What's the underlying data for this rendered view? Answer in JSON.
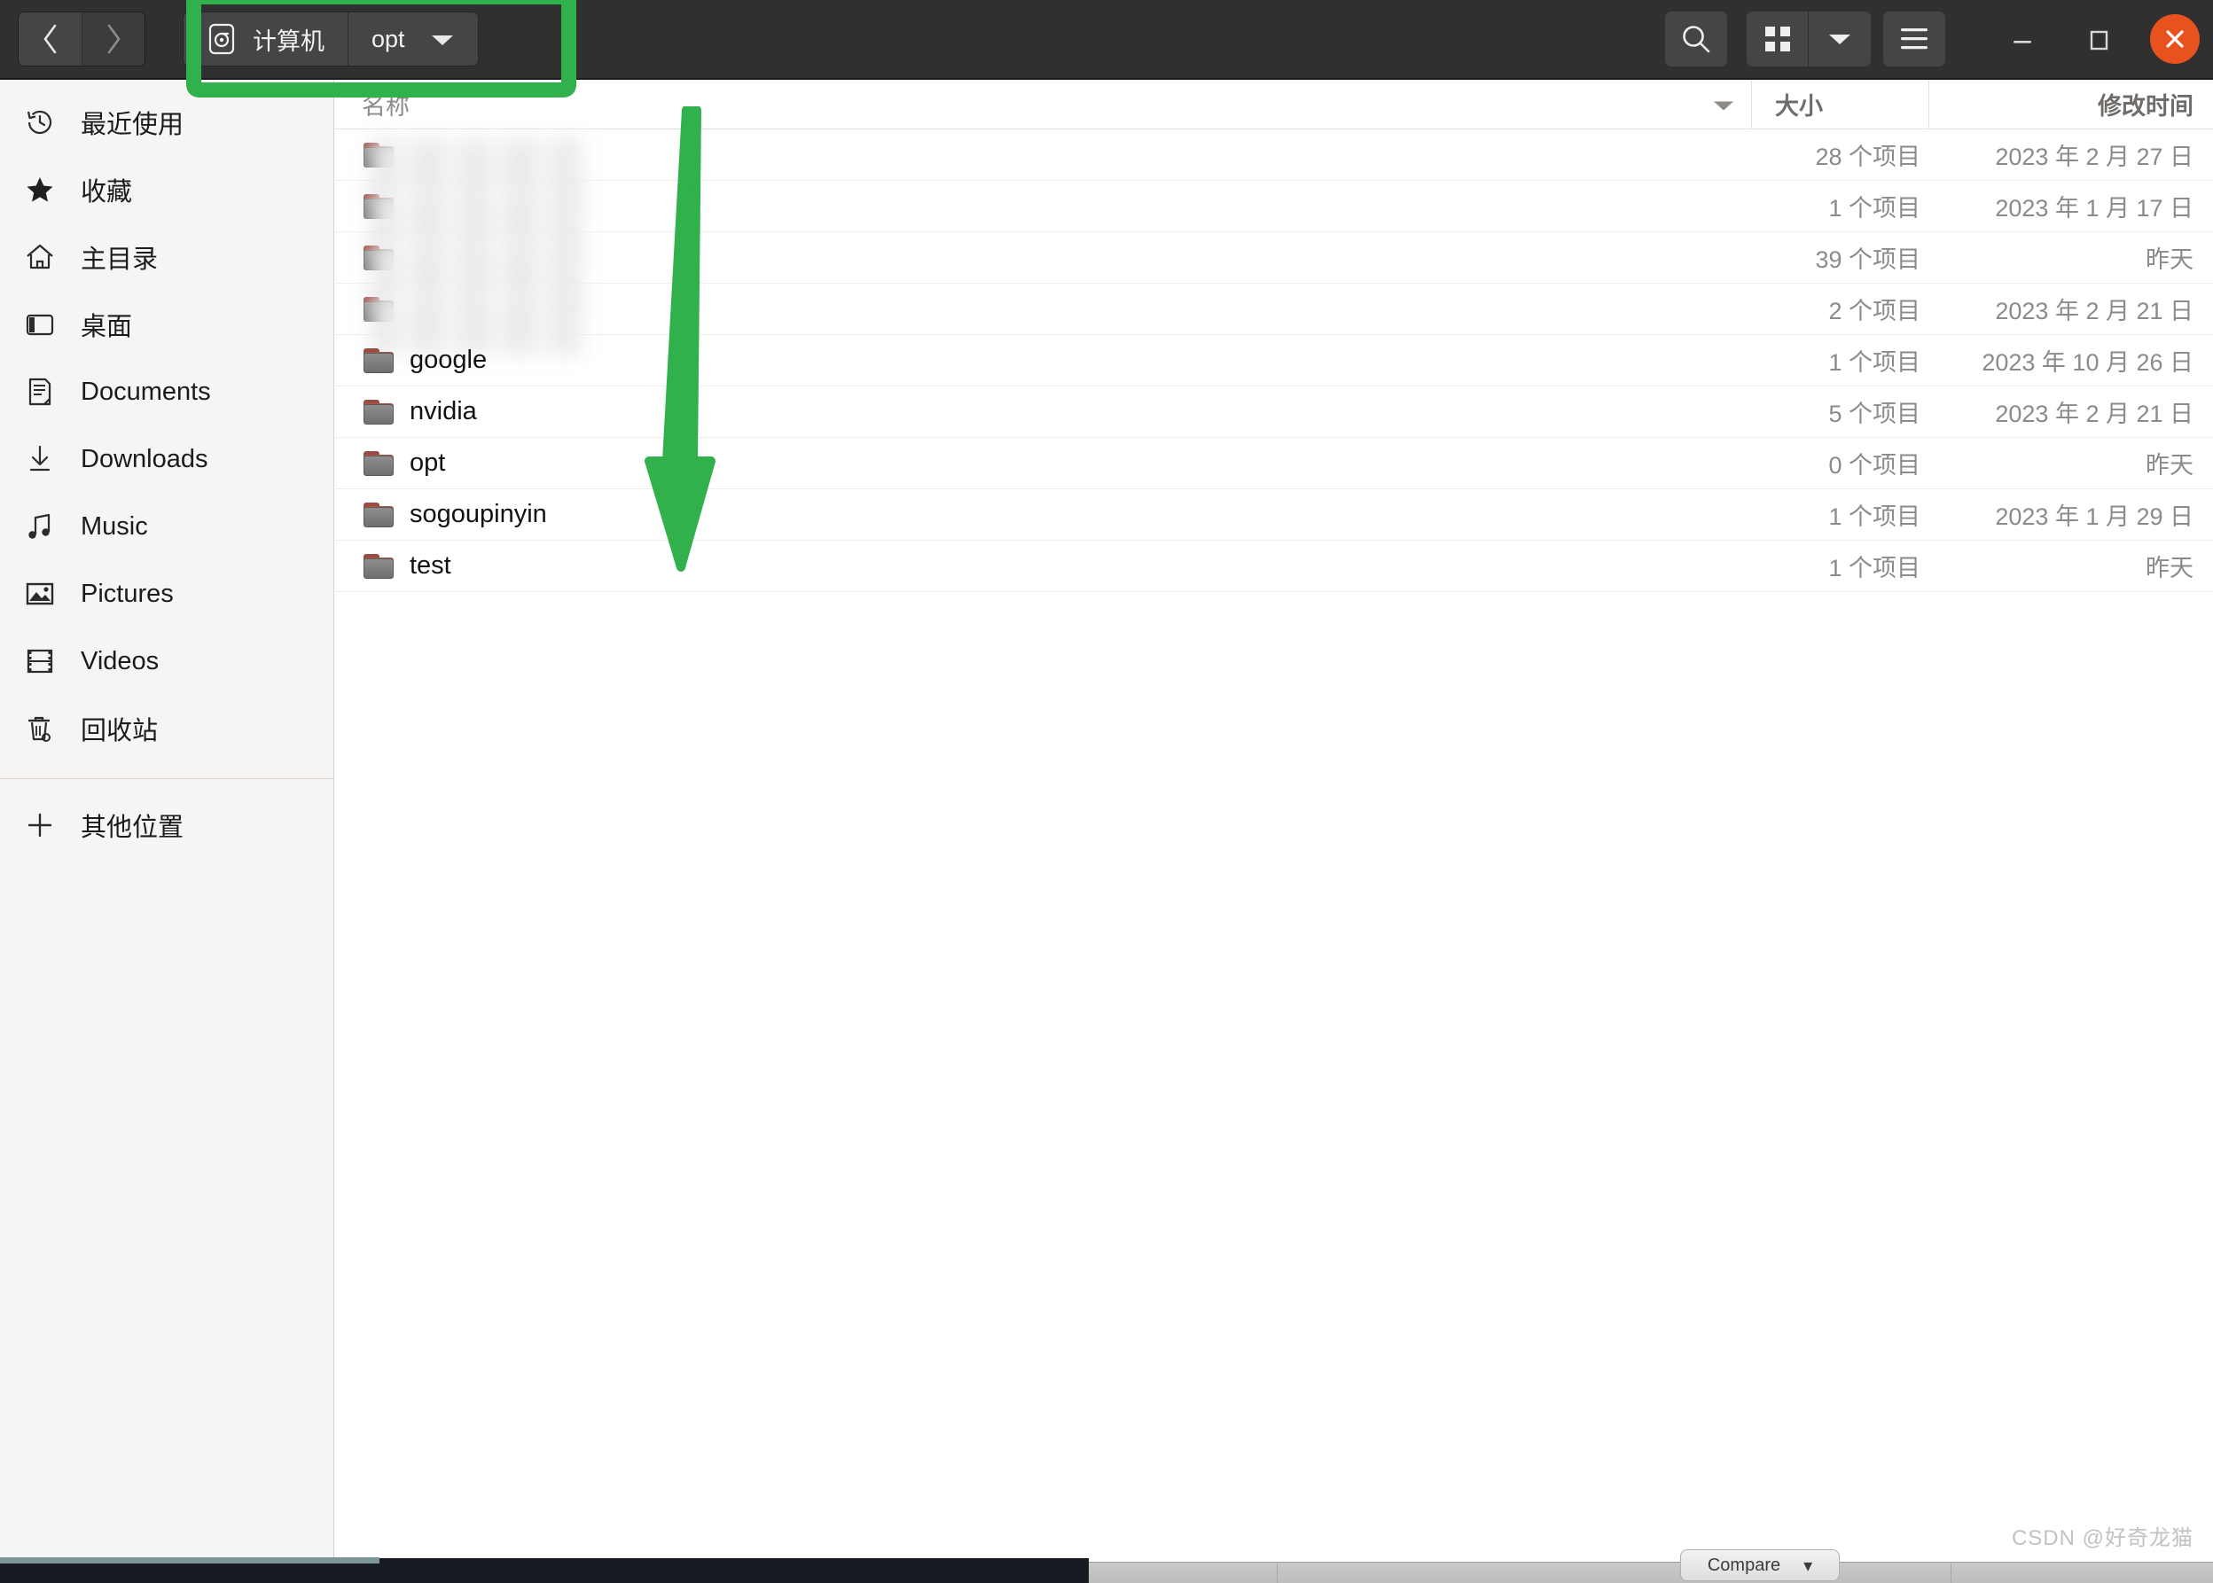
{
  "window": {
    "titlebar": {
      "back_label": "‹",
      "forward_label": "›",
      "path_root_label": "计算机",
      "path_current_label": "opt",
      "search_icon": "search-icon",
      "grid_icon": "grid-view-icon",
      "view_dropdown_icon": "chevron-down-icon",
      "menu_icon": "hamburger-menu-icon",
      "minimize_label": "—",
      "maximize_label": "□",
      "close_label": "✕"
    }
  },
  "sidebar": {
    "items": [
      {
        "label": "最近使用",
        "icon": "history-clock-icon"
      },
      {
        "label": "收藏",
        "icon": "star-icon"
      },
      {
        "label": "主目录",
        "icon": "home-icon"
      },
      {
        "label": "桌面",
        "icon": "desktop-icon"
      },
      {
        "label": "Documents",
        "icon": "document-icon"
      },
      {
        "label": "Downloads",
        "icon": "download-icon"
      },
      {
        "label": "Music",
        "icon": "music-note-icon"
      },
      {
        "label": "Pictures",
        "icon": "picture-icon"
      },
      {
        "label": "Videos",
        "icon": "film-icon"
      },
      {
        "label": "回收站",
        "icon": "trash-icon"
      }
    ],
    "other_locations": {
      "label": "其他位置",
      "icon": "plus-icon"
    }
  },
  "file_list": {
    "columns": {
      "name": "名称",
      "size": "大小",
      "modified": "修改时间"
    },
    "sort_indicator": "sort-ascending-caret",
    "rows": [
      {
        "name": "",
        "redacted": true,
        "size": "28 个项目",
        "modified": "2023 年 2 月 27 日"
      },
      {
        "name": "",
        "redacted": true,
        "size": "1 个项目",
        "modified": "2023 年 1 月 17 日"
      },
      {
        "name": "",
        "redacted": true,
        "size": "39 个项目",
        "modified": "昨天"
      },
      {
        "name": "",
        "redacted": true,
        "size": "2 个项目",
        "modified": "2023 年 2 月 21 日"
      },
      {
        "name": "google",
        "redacted": false,
        "size": "1 个项目",
        "modified": "2023 年 10 月 26 日"
      },
      {
        "name": "nvidia",
        "redacted": false,
        "size": "5 个项目",
        "modified": "2023 年 2 月 21 日"
      },
      {
        "name": "opt",
        "redacted": false,
        "size": "0 个项目",
        "modified": "昨天"
      },
      {
        "name": "sogoupinyin",
        "redacted": false,
        "size": "1 个项目",
        "modified": "2023 年 1 月 29 日"
      },
      {
        "name": "test",
        "redacted": false,
        "size": "1 个项目",
        "modified": "昨天"
      }
    ]
  },
  "annotations": {
    "highlight_box": {
      "target": "path-bar",
      "color": "#31b14c"
    },
    "arrow": {
      "direction": "down",
      "color": "#31b14c"
    }
  },
  "taskbar": {
    "compare_label": "Compare",
    "compare_caret": "▾"
  },
  "watermark": {
    "text": "CSDN @好奇龙猫"
  },
  "colors": {
    "accent_green": "#31b14c",
    "close_red": "#e8521f",
    "headerbar": "#303030",
    "sidebar_bg": "#f6f5f4"
  }
}
